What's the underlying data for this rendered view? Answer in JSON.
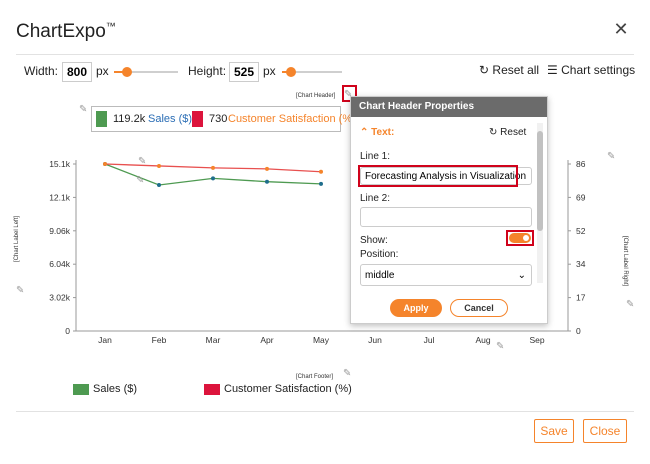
{
  "app": {
    "title": "ChartExpo",
    "tm": "™"
  },
  "toolbar": {
    "width_label": "Width:",
    "width_value": "800",
    "width_unit": "px",
    "height_label": "Height:",
    "height_value": "525",
    "height_unit": "px",
    "reset_label": "Reset all",
    "settings_label": "Chart settings",
    "reset_icon": "↻",
    "settings_icon": "☰"
  },
  "chart": {
    "header_placeholder": "[Chart Header]",
    "footer_placeholder": "[Chart Footer]",
    "label_left": "[Chart Label Left]",
    "label_right": "[Chart Label Right]",
    "legend_top": [
      {
        "value": "119.2k",
        "name": "Sales ($)",
        "color": "#4e9a51"
      },
      {
        "value": "730",
        "name": "Customer Satisfaction (%)",
        "color": "#dc143c"
      }
    ],
    "legend_bottom": [
      {
        "name": "Sales ($)",
        "color": "#4e9a51"
      },
      {
        "name": "Customer Satisfaction (%)",
        "color": "#dc143c"
      }
    ]
  },
  "chart_data": {
    "type": "line",
    "categories": [
      "Jan",
      "Feb",
      "Mar",
      "Apr",
      "May",
      "Jun",
      "Jul",
      "Aug",
      "Sep"
    ],
    "y_left_ticks": [
      "0",
      "3.02k",
      "6.04k",
      "9.06k",
      "12.1k",
      "15.1k"
    ],
    "y_right_ticks": [
      "0",
      "17",
      "34",
      "52",
      "69",
      "86"
    ],
    "ylim_left": [
      0,
      15100
    ],
    "ylim_right": [
      0,
      86
    ],
    "series": [
      {
        "name": "Sales ($)",
        "axis": "left",
        "color": "#4e9a51",
        "values": [
          15100,
          13200,
          13800,
          13500,
          13300
        ]
      },
      {
        "name": "Customer Satisfaction (%)",
        "axis": "right",
        "color": "#e8504f",
        "values": [
          86,
          85,
          84,
          83.5,
          82
        ]
      }
    ]
  },
  "panel": {
    "title": "Chart Header Properties",
    "section": "Text:",
    "reset": "Reset",
    "line1_label": "Line 1:",
    "line1_value": "Forecasting Analysis in Visualization",
    "line2_label": "Line 2:",
    "line2_value": "",
    "show_label": "Show:",
    "position_label": "Position:",
    "position_value": "middle",
    "apply": "Apply",
    "cancel": "Cancel"
  },
  "footer": {
    "save": "Save",
    "close": "Close"
  }
}
